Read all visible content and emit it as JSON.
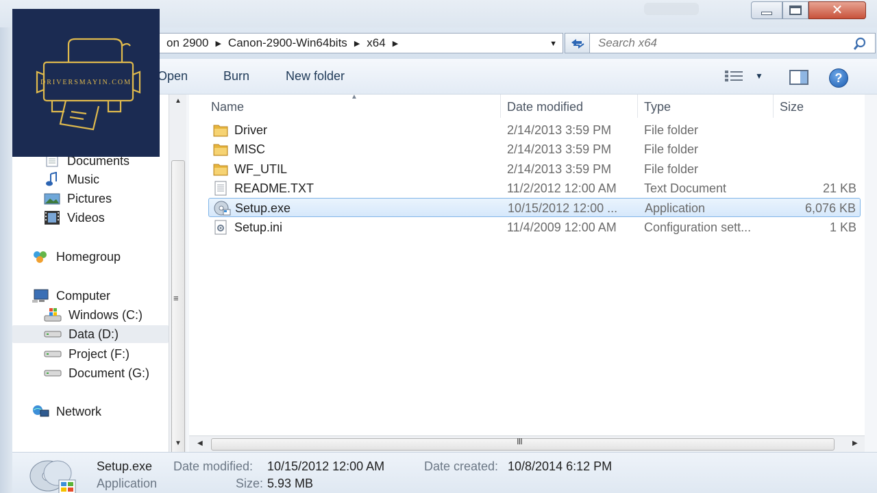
{
  "window": {
    "controls": {
      "minimize": "minimize",
      "maximize": "maximize",
      "close": "close"
    }
  },
  "address": {
    "crumbs": [
      "on 2900",
      "Canon-2900-Win64bits",
      "x64"
    ],
    "search_placeholder": "Search x64"
  },
  "toolbar": {
    "open_label": "Open",
    "burn_label": "Burn",
    "new_folder_label": "New folder"
  },
  "nav": {
    "libraries": [
      {
        "label": "Documents",
        "icon": "documents-icon"
      },
      {
        "label": "Music",
        "icon": "music-icon"
      },
      {
        "label": "Pictures",
        "icon": "pictures-icon"
      },
      {
        "label": "Videos",
        "icon": "videos-icon"
      }
    ],
    "homegroup": "Homegroup",
    "computer": "Computer",
    "drives": [
      {
        "label": "Windows (C:)",
        "icon": "windows-drive-icon",
        "selected": false
      },
      {
        "label": "Data (D:)",
        "icon": "drive-icon",
        "selected": true
      },
      {
        "label": "Project (F:)",
        "icon": "drive-icon",
        "selected": false
      },
      {
        "label": "Document (G:)",
        "icon": "drive-icon",
        "selected": false
      }
    ],
    "network": "Network"
  },
  "file_list": {
    "columns": {
      "name": "Name",
      "date": "Date modified",
      "type": "Type",
      "size": "Size"
    },
    "rows": [
      {
        "name": "Driver",
        "date": "2/14/2013 3:59 PM",
        "type": "File folder",
        "size": "",
        "icon": "folder-icon",
        "selected": false
      },
      {
        "name": "MISC",
        "date": "2/14/2013 3:59 PM",
        "type": "File folder",
        "size": "",
        "icon": "folder-icon",
        "selected": false
      },
      {
        "name": "WF_UTIL",
        "date": "2/14/2013 3:59 PM",
        "type": "File folder",
        "size": "",
        "icon": "folder-icon",
        "selected": false
      },
      {
        "name": "README.TXT",
        "date": "11/2/2012 12:00 AM",
        "type": "Text Document",
        "size": "21 KB",
        "icon": "text-file-icon",
        "selected": false
      },
      {
        "name": "Setup.exe",
        "date": "10/15/2012 12:00 ...",
        "type": "Application",
        "size": "6,076 KB",
        "icon": "setup-exe-icon",
        "selected": true
      },
      {
        "name": "Setup.ini",
        "date": "11/4/2009 12:00 AM",
        "type": "Configuration sett...",
        "size": "1 KB",
        "icon": "config-file-icon",
        "selected": false
      }
    ]
  },
  "details": {
    "file_name": "Setup.exe",
    "file_type": "Application",
    "date_modified_label": "Date modified:",
    "date_modified": "10/15/2012 12:00 AM",
    "date_created_label": "Date created:",
    "date_created": "10/8/2014 6:12 PM",
    "size_label": "Size:",
    "size": "5.93 MB"
  },
  "watermark": {
    "text": "DRIVERSMAYIN.COM"
  },
  "colors": {
    "selection": "#d6e8fb",
    "selection_border": "#7fb4e8",
    "logo_bg": "#1b2b52",
    "logo_gold": "#e0ba4d"
  }
}
